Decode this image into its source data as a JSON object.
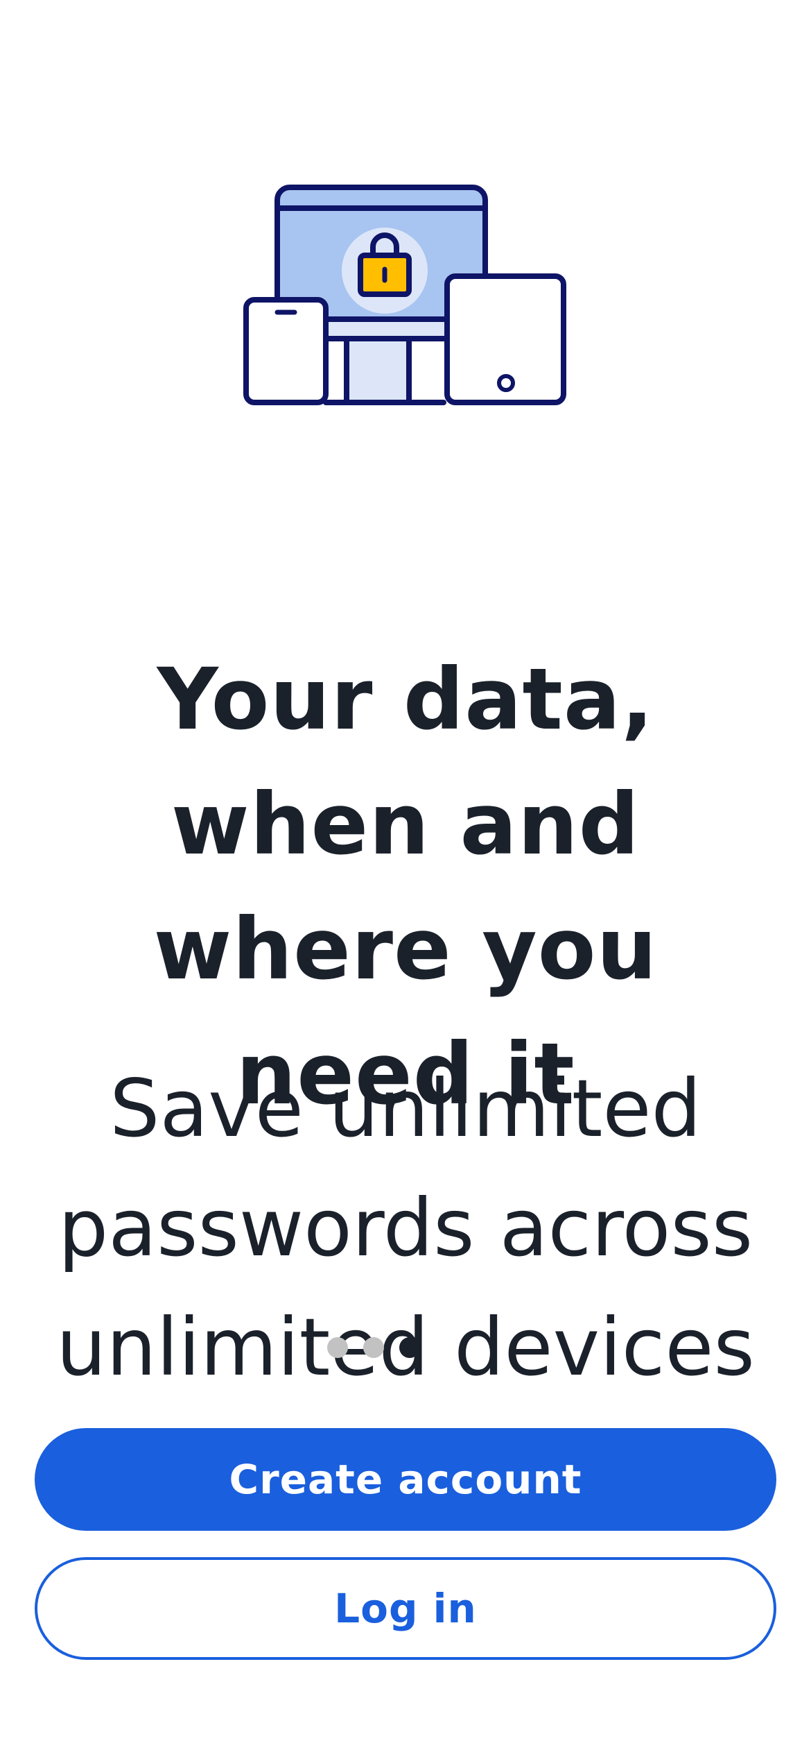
{
  "onboarding": {
    "hero_icon": "devices-lock-illustration",
    "title": "Your data, when and where you need it",
    "subtitle": "Save unlimited passwords across unlimited devices",
    "pager": {
      "total": 3,
      "active_index": 2
    }
  },
  "actions": {
    "create_account_label": "Create account",
    "login_label": "Log in"
  },
  "colors": {
    "accent": "#1a5fdd",
    "text": "#1b212b",
    "illustration_outline": "#0e1466",
    "illustration_fill": "#a8c4f0",
    "lock": "#ffbf00",
    "dot_inactive": "#c2c2c2"
  }
}
